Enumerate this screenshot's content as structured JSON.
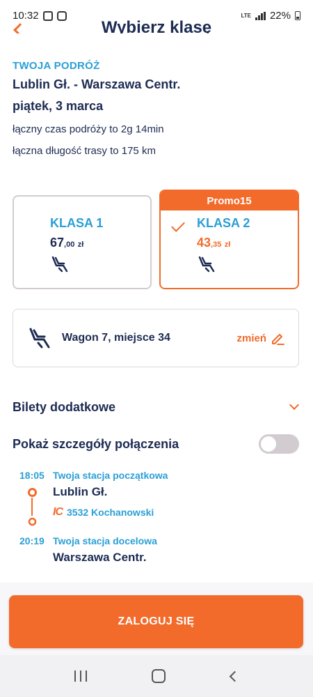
{
  "status_bar": {
    "time": "10:32",
    "network": "LTE",
    "battery": "22%"
  },
  "header": {
    "title": "Wybierz klasę"
  },
  "journey": {
    "label": "TWOJA PODRÓŻ",
    "route": "Lublin Gł. - Warszawa Centr.",
    "date": "piątek, 3 marca",
    "duration": "łączny czas podróży to 2g 14min",
    "distance": "łączna długość trasy to 175 km"
  },
  "classes": [
    {
      "name": "KLASA 1",
      "price_main": "67",
      "price_frac": ",00",
      "currency": "zł",
      "selected": false
    },
    {
      "name": "KLASA 2",
      "price_main": "43",
      "price_frac": ",35",
      "currency": "zł",
      "selected": true,
      "promo": "Promo15"
    }
  ],
  "seat": {
    "text": "Wagon 7, miejsce 34",
    "change_label": "zmień"
  },
  "extra_tickets": {
    "label": "Bilety dodatkowe"
  },
  "details": {
    "label": "Pokaż szczegóły połączenia",
    "toggle_on": false
  },
  "timeline": {
    "departure": {
      "time": "18:05",
      "label": "Twoja stacja początkowa",
      "station": "Lublin Gł."
    },
    "train": {
      "carrier": "IC",
      "name": "3532 Kochanowski"
    },
    "arrival": {
      "time": "20:19",
      "label": "Twoja stacja docelowa",
      "station": "Warszawa Centr."
    }
  },
  "login_button": {
    "label": "ZALOGUJ SIĘ"
  },
  "colors": {
    "accent": "#f26b2a",
    "blue": "#2a9fd6",
    "navy": "#1d2b53"
  }
}
